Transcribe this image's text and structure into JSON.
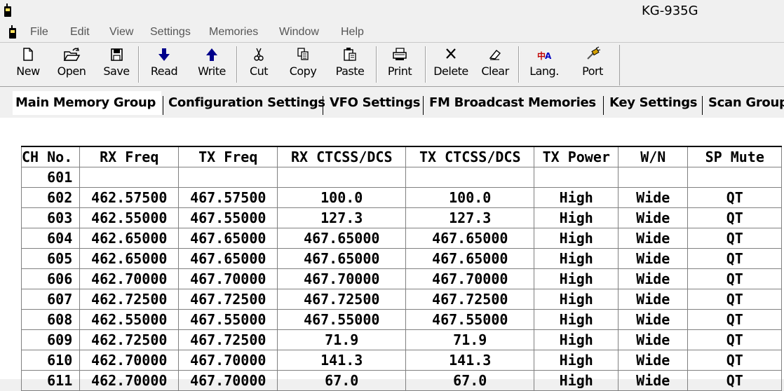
{
  "window": {
    "title": "KG-935G",
    "app_icon": "radio-icon"
  },
  "menu": {
    "icon": "radio-icon",
    "items": [
      "File",
      "Edit",
      "View",
      "Settings",
      "Memories",
      "Window",
      "Help"
    ]
  },
  "toolbar": {
    "buttons": [
      {
        "label": "New",
        "icon": "new-document-icon"
      },
      {
        "label": "Open",
        "icon": "open-folder-icon"
      },
      {
        "label": "Save",
        "icon": "save-disk-icon"
      },
      {
        "label": "Read",
        "icon": "arrow-down-icon"
      },
      {
        "label": "Write",
        "icon": "arrow-up-icon"
      },
      {
        "label": "Cut",
        "icon": "scissors-icon"
      },
      {
        "label": "Copy",
        "icon": "copy-icon"
      },
      {
        "label": "Paste",
        "icon": "paste-icon"
      },
      {
        "label": "Print",
        "icon": "printer-icon"
      },
      {
        "label": "Delete",
        "icon": "delete-x-icon"
      },
      {
        "label": "Clear",
        "icon": "eraser-icon"
      },
      {
        "label": "Lang.",
        "icon": "language-icon"
      },
      {
        "label": "Port",
        "icon": "port-icon"
      }
    ]
  },
  "tabs": [
    {
      "label": "Main Memory Group",
      "active": true
    },
    {
      "label": "Configuration Settings",
      "active": false
    },
    {
      "label": "VFO Settings",
      "active": false
    },
    {
      "label": "FM Broadcast Memories",
      "active": false
    },
    {
      "label": "Key Settings",
      "active": false
    },
    {
      "label": "Scan Group",
      "active": false
    }
  ],
  "grid": {
    "columns": [
      "CH No.",
      "RX Freq",
      "TX Freq",
      "RX CTCSS/DCS",
      "TX CTCSS/DCS",
      "TX Power",
      "W/N",
      "SP Mute"
    ],
    "rows": [
      [
        "601",
        "",
        "",
        "",
        "",
        "",
        "",
        ""
      ],
      [
        "602",
        "462.57500",
        "467.57500",
        "100.0",
        "100.0",
        "High",
        "Wide",
        "QT"
      ],
      [
        "603",
        "462.55000",
        "467.55000",
        "127.3",
        "127.3",
        "High",
        "Wide",
        "QT"
      ],
      [
        "604",
        "462.65000",
        "467.65000",
        "467.65000",
        "467.65000",
        "High",
        "Wide",
        "QT"
      ],
      [
        "605",
        "462.65000",
        "467.65000",
        "467.65000",
        "467.65000",
        "High",
        "Wide",
        "QT"
      ],
      [
        "606",
        "462.70000",
        "467.70000",
        "467.70000",
        "467.70000",
        "High",
        "Wide",
        "QT"
      ],
      [
        "607",
        "462.72500",
        "467.72500",
        "467.72500",
        "467.72500",
        "High",
        "Wide",
        "QT"
      ],
      [
        "608",
        "462.55000",
        "467.55000",
        "467.55000",
        "467.55000",
        "High",
        "Wide",
        "QT"
      ],
      [
        "609",
        "462.72500",
        "467.72500",
        "71.9",
        "71.9",
        "High",
        "Wide",
        "QT"
      ],
      [
        "610",
        "462.70000",
        "467.70000",
        "141.3",
        "141.3",
        "High",
        "Wide",
        "QT"
      ],
      [
        "611",
        "462.70000",
        "467.70000",
        "67.0",
        "67.0",
        "High",
        "Wide",
        "QT"
      ]
    ]
  }
}
